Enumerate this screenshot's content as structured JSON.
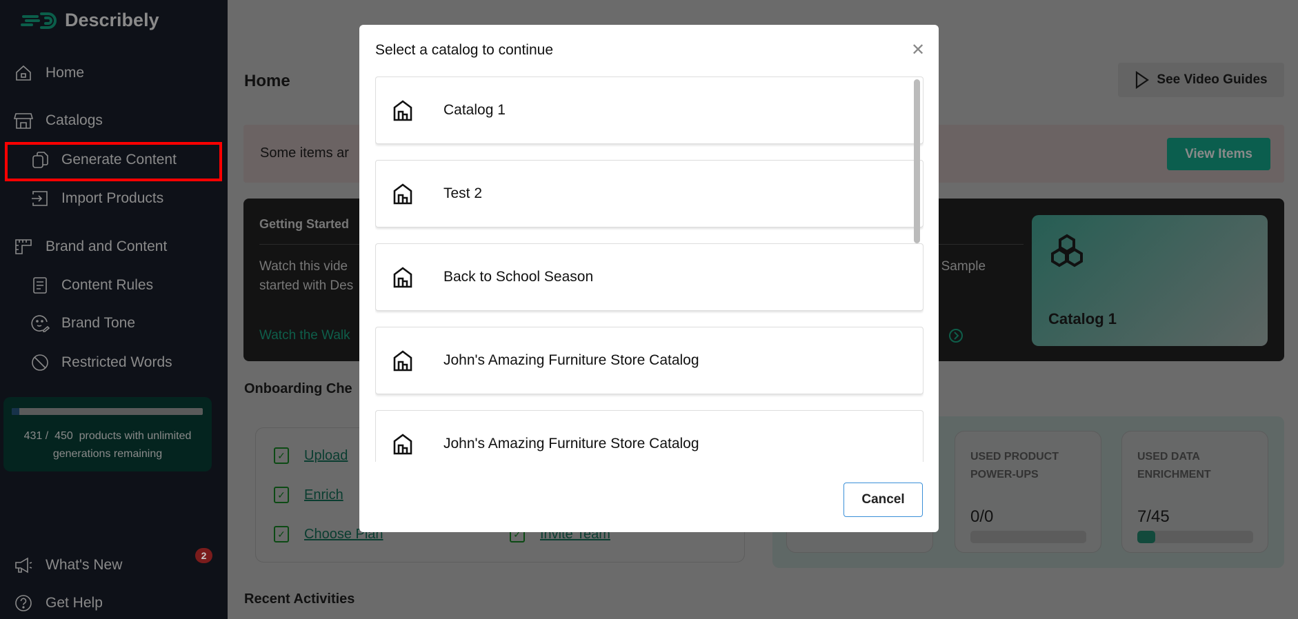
{
  "app": {
    "brand": "Describely"
  },
  "sidebar": {
    "items": [
      {
        "label": "Home",
        "icon": "home-icon"
      },
      {
        "label": "Catalogs",
        "icon": "store-icon"
      },
      {
        "label": "Generate Content",
        "icon": "copy-icon"
      },
      {
        "label": "Import Products",
        "icon": "import-icon"
      },
      {
        "label": "Brand and Content",
        "icon": "ruler-icon"
      },
      {
        "label": "Content Rules",
        "icon": "document-icon"
      },
      {
        "label": "Brand Tone",
        "icon": "face-icon"
      },
      {
        "label": "Restricted Words",
        "icon": "ban-icon"
      }
    ],
    "usage": {
      "used": "431",
      "total": "450",
      "text": "products with unlimited generations remaining",
      "bar_fill_fraction": 0.04
    },
    "whats_new": "What's New",
    "whats_new_badge": "2",
    "get_help": "Get Help"
  },
  "main": {
    "title": "Home",
    "video_guides": "See Video Guides",
    "banner_text": "Some items ar",
    "view_items": "View Items",
    "getting_started": {
      "title": "Getting Started",
      "text_line1": "Watch this vide",
      "text_line2": "started with Des",
      "link": "Watch the Walk",
      "right_text": "r Sample"
    },
    "catalog_card": "Catalog 1",
    "onboarding_title": "Onboarding Che",
    "checklist": [
      "Upload",
      "Enrich",
      "Choose Plan",
      "Invite Team"
    ],
    "stats": [
      {
        "label": "USED PRODUCT POWER-UPS",
        "value": "0/0",
        "fraction": 0
      },
      {
        "label": "USED DATA ENRICHMENT",
        "value": "7/45",
        "fraction": 0.155
      }
    ],
    "recent_title": "Recent Activities"
  },
  "modal": {
    "title": "Select a catalog to continue",
    "catalogs": [
      "Catalog 1",
      "Test 2",
      "Back to School Season",
      "John's Amazing Furniture Store Catalog",
      "John's Amazing Furniture Store Catalog"
    ],
    "cancel": "Cancel",
    "accent": "#3a8fd8"
  }
}
